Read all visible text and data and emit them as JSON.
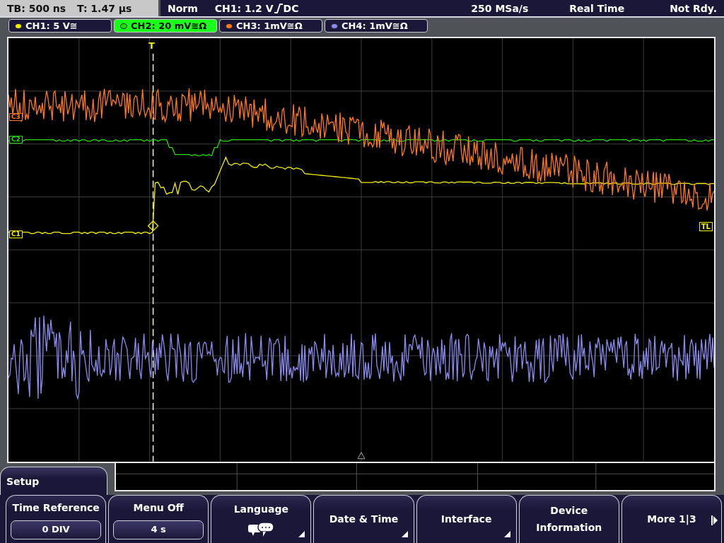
{
  "status_bar": {
    "timebase": "TB: 500 ns",
    "trigger_time": "T: 1.47 µs",
    "trigger_mode": "Norm",
    "trigger_source": "CH1: 1.2 V",
    "trigger_coupling": "DC",
    "sample_rate": "250 MSa/s",
    "acquisition": "Real Time",
    "state": "Not Rdy."
  },
  "channels": [
    {
      "label": "CH1: 5 V≅",
      "color": "#f2ee00",
      "selected": false
    },
    {
      "label": "CH2: 20 mV≅Ω",
      "color": "#22e000",
      "selected": true
    },
    {
      "label": "CH3: 1mV≅Ω",
      "color": "#ff7a1c",
      "selected": false
    },
    {
      "label": "CH4: 1mV≅Ω",
      "color": "#8c8cf0",
      "selected": false
    }
  ],
  "display": {
    "trigger_marker": "T",
    "channel_markers": [
      {
        "label": "C3",
        "color": "#ff7a1c"
      },
      {
        "label": "C2",
        "color": "#22e000"
      },
      {
        "label": "C1",
        "color": "#f2ee00"
      }
    ],
    "trigger_level_marker": "TL"
  },
  "menu": {
    "title": "Setup",
    "softkeys": [
      {
        "kind": "value",
        "label": "Time Reference",
        "value": "0 DIV",
        "submenu": false
      },
      {
        "kind": "value",
        "label": "Menu Off",
        "value": "4 s",
        "submenu": false
      },
      {
        "kind": "icon",
        "label": "Language",
        "submenu": true
      },
      {
        "kind": "plain",
        "label": "Date & Time",
        "submenu": true
      },
      {
        "kind": "plain",
        "label": "Interface",
        "submenu": true
      },
      {
        "kind": "plain",
        "label": "Device Information",
        "submenu": false
      },
      {
        "kind": "next",
        "label": "More 1|3",
        "submenu": false
      }
    ]
  }
}
